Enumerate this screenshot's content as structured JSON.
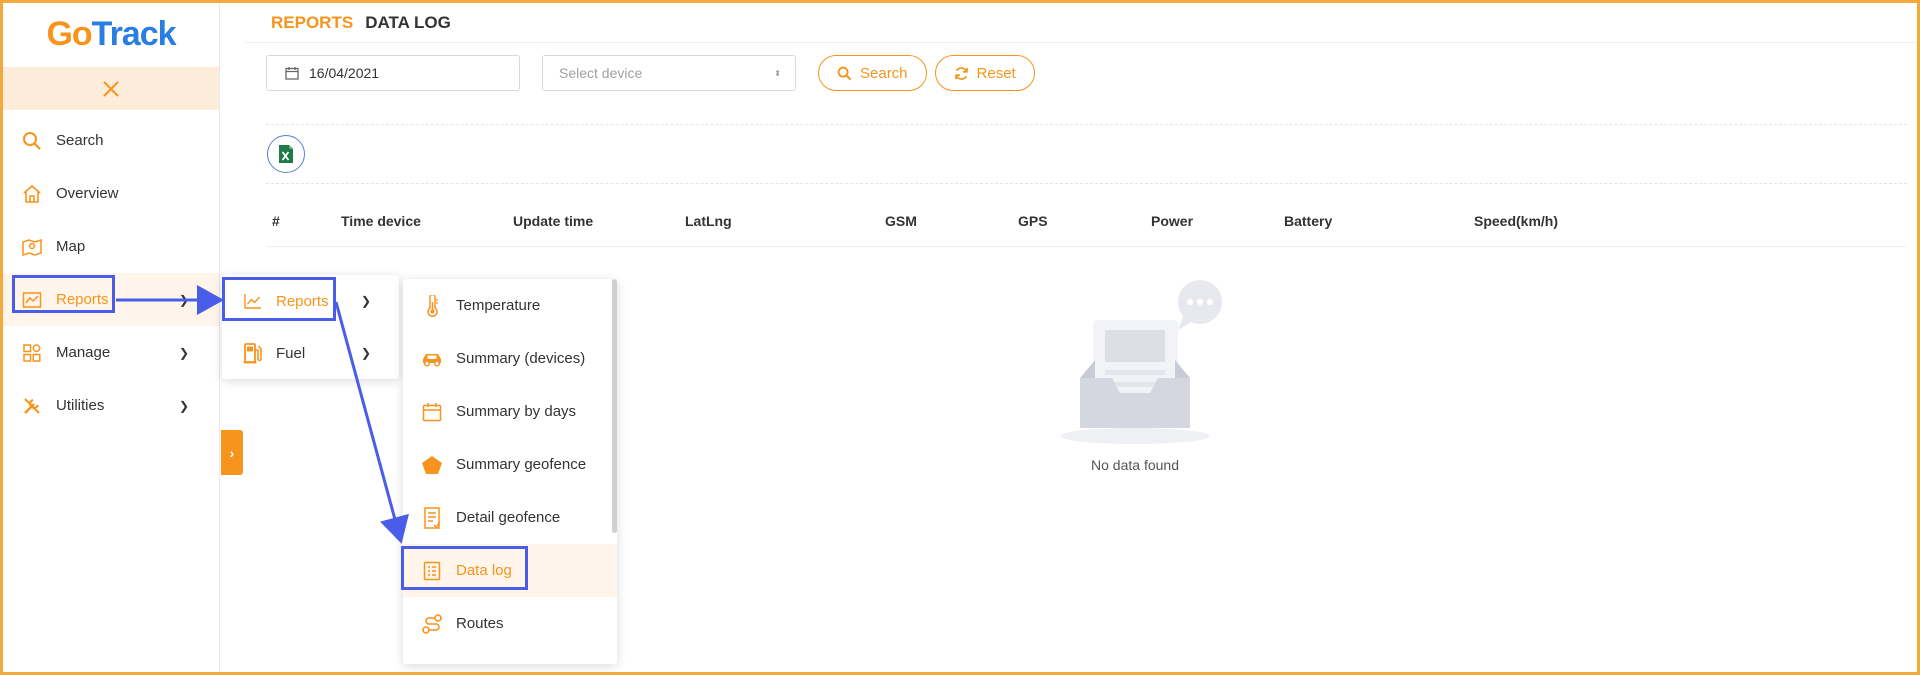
{
  "app": {
    "logo_go": "Go",
    "logo_track": "Track"
  },
  "sidebar": {
    "items": [
      {
        "label": "Search",
        "icon": "search-icon"
      },
      {
        "label": "Overview",
        "icon": "home-icon"
      },
      {
        "label": "Map",
        "icon": "map-icon"
      },
      {
        "label": "Reports",
        "icon": "chart-icon"
      },
      {
        "label": "Manage",
        "icon": "grid-icon"
      },
      {
        "label": "Utilities",
        "icon": "tools-icon"
      }
    ]
  },
  "breadcrumb": {
    "section": "REPORTS",
    "page": "DATA LOG"
  },
  "filters": {
    "date": "16/04/2021",
    "device_placeholder": "Select device",
    "search_label": "Search",
    "reset_label": "Reset"
  },
  "table": {
    "columns": [
      "#",
      "Time device",
      "Update time",
      "LatLng",
      "GSM",
      "GPS",
      "Power",
      "Battery",
      "Speed(km/h)"
    ],
    "empty_message": "No data found"
  },
  "reports_menu": {
    "items": [
      {
        "label": "Reports",
        "icon": "line-chart-icon"
      },
      {
        "label": "Fuel",
        "icon": "fuel-pump-icon"
      }
    ]
  },
  "reports_submenu": {
    "items": [
      {
        "label": "Temperature",
        "icon": "thermometer-icon"
      },
      {
        "label": "Summary (devices)",
        "icon": "car-icon"
      },
      {
        "label": "Summary by days",
        "icon": "calendar-icon"
      },
      {
        "label": "Summary geofence",
        "icon": "pentagon-icon"
      },
      {
        "label": "Detail geofence",
        "icon": "document-icon"
      },
      {
        "label": "Data log",
        "icon": "list-icon"
      },
      {
        "label": "Routes",
        "icon": "route-icon"
      }
    ]
  },
  "colors": {
    "accent": "#f7941d",
    "brand_blue": "#2a7de1",
    "annotation": "#4a5de8"
  }
}
